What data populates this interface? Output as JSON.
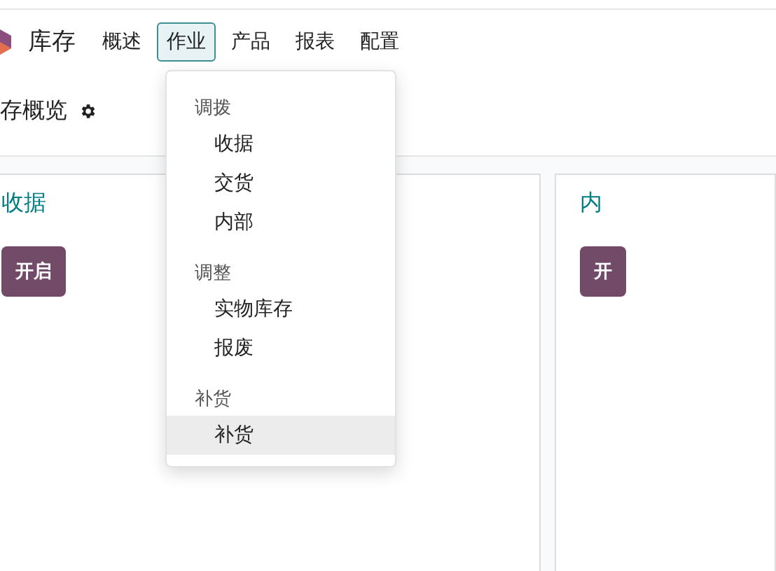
{
  "app": {
    "title": "库存"
  },
  "nav": [
    {
      "label": "概述",
      "selected": false
    },
    {
      "label": "作业",
      "selected": true
    },
    {
      "label": "产品",
      "selected": false
    },
    {
      "label": "报表",
      "selected": false
    },
    {
      "label": "配置",
      "selected": false
    }
  ],
  "page_title": "存概览",
  "cards": [
    {
      "title": "收据",
      "button": "开启"
    },
    {
      "title": "内",
      "button": "开"
    }
  ],
  "dropdown": {
    "sections": [
      {
        "header": "调拨",
        "items": [
          {
            "label": "收据",
            "selected": false
          },
          {
            "label": "交货",
            "selected": false
          },
          {
            "label": "内部",
            "selected": false
          }
        ]
      },
      {
        "header": "调整",
        "items": [
          {
            "label": "实物库存",
            "selected": false
          },
          {
            "label": "报废",
            "selected": false
          }
        ]
      },
      {
        "header": "补货",
        "items": [
          {
            "label": "补货",
            "selected": true
          }
        ]
      }
    ]
  }
}
